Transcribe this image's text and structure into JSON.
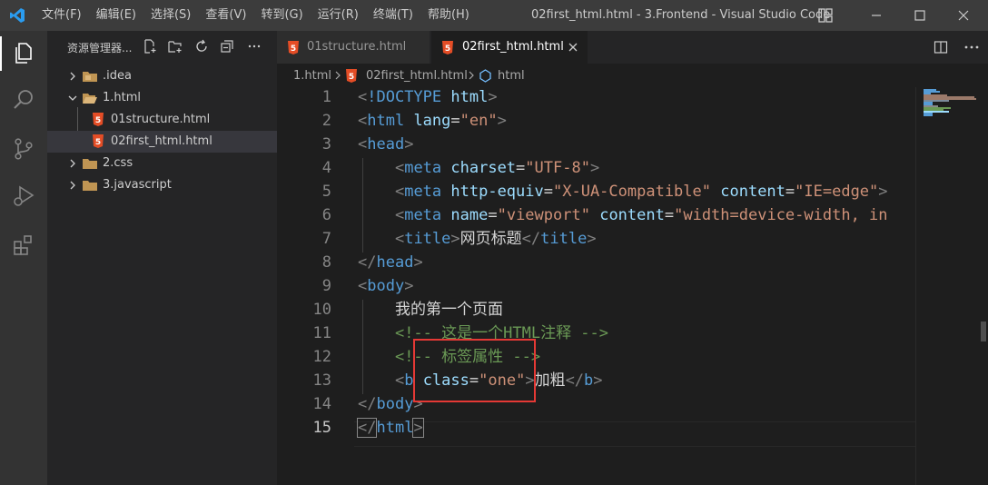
{
  "titlebar": {
    "menu": [
      "文件(F)",
      "编辑(E)",
      "选择(S)",
      "查看(V)",
      "转到(G)",
      "运行(R)",
      "终端(T)",
      "帮助(H)"
    ],
    "window_title": "02first_html.html - 3.Frontend - Visual Studio Code"
  },
  "sidebar": {
    "title": "资源管理器...",
    "tree": [
      {
        "label": ".idea",
        "type": "folder",
        "expanded": false
      },
      {
        "label": "1.html",
        "type": "folder",
        "expanded": true
      },
      {
        "label": "01structure.html",
        "type": "file-html"
      },
      {
        "label": "02first_html.html",
        "type": "file-html",
        "selected": true
      },
      {
        "label": "2.css",
        "type": "folder",
        "expanded": false
      },
      {
        "label": "3.javascript",
        "type": "folder",
        "expanded": false
      }
    ]
  },
  "tabs": [
    {
      "label": "01structure.html",
      "active": false
    },
    {
      "label": "02first_html.html",
      "active": true
    }
  ],
  "breadcrumb": [
    "1.html",
    "02first_html.html",
    "html"
  ],
  "editor": {
    "current_line": 15,
    "lines": [
      {
        "n": "1",
        "tokens": [
          [
            "t-punc",
            "<"
          ],
          [
            "t-tag",
            "!DOCTYPE "
          ],
          [
            "t-attr",
            "html"
          ],
          [
            "t-punc",
            ">"
          ]
        ]
      },
      {
        "n": "2",
        "tokens": [
          [
            "t-punc",
            "<"
          ],
          [
            "t-tag",
            "html "
          ],
          [
            "t-attr",
            "lang"
          ],
          [
            "t-text",
            "="
          ],
          [
            "t-str",
            "\"en\""
          ],
          [
            "t-punc",
            ">"
          ]
        ]
      },
      {
        "n": "3",
        "tokens": [
          [
            "t-punc",
            "<"
          ],
          [
            "t-tag",
            "head"
          ],
          [
            "t-punc",
            ">"
          ]
        ]
      },
      {
        "n": "4",
        "tokens": [
          [
            "t-text",
            "    "
          ],
          [
            "t-punc",
            "<"
          ],
          [
            "t-tag",
            "meta "
          ],
          [
            "t-attr",
            "charset"
          ],
          [
            "t-text",
            "="
          ],
          [
            "t-str",
            "\"UTF-8\""
          ],
          [
            "t-punc",
            ">"
          ]
        ]
      },
      {
        "n": "5",
        "tokens": [
          [
            "t-text",
            "    "
          ],
          [
            "t-punc",
            "<"
          ],
          [
            "t-tag",
            "meta "
          ],
          [
            "t-attr",
            "http-equiv"
          ],
          [
            "t-text",
            "="
          ],
          [
            "t-str",
            "\"X-UA-Compatible\""
          ],
          [
            "t-text",
            " "
          ],
          [
            "t-attr",
            "content"
          ],
          [
            "t-text",
            "="
          ],
          [
            "t-str",
            "\"IE=edge\""
          ],
          [
            "t-punc",
            ">"
          ]
        ]
      },
      {
        "n": "6",
        "tokens": [
          [
            "t-text",
            "    "
          ],
          [
            "t-punc",
            "<"
          ],
          [
            "t-tag",
            "meta "
          ],
          [
            "t-attr",
            "name"
          ],
          [
            "t-text",
            "="
          ],
          [
            "t-str",
            "\"viewport\""
          ],
          [
            "t-text",
            " "
          ],
          [
            "t-attr",
            "content"
          ],
          [
            "t-text",
            "="
          ],
          [
            "t-str",
            "\"width=device-width, in"
          ]
        ]
      },
      {
        "n": "7",
        "tokens": [
          [
            "t-text",
            "    "
          ],
          [
            "t-punc",
            "<"
          ],
          [
            "t-tag",
            "title"
          ],
          [
            "t-punc",
            ">"
          ],
          [
            "t-text",
            "网页标题"
          ],
          [
            "t-punc",
            "</"
          ],
          [
            "t-tag",
            "title"
          ],
          [
            "t-punc",
            ">"
          ]
        ]
      },
      {
        "n": "8",
        "tokens": [
          [
            "t-punc",
            "</"
          ],
          [
            "t-tag",
            "head"
          ],
          [
            "t-punc",
            ">"
          ]
        ]
      },
      {
        "n": "9",
        "tokens": [
          [
            "t-punc",
            "<"
          ],
          [
            "t-tag",
            "body"
          ],
          [
            "t-punc",
            ">"
          ]
        ]
      },
      {
        "n": "10",
        "tokens": [
          [
            "t-text",
            "    我的第一个页面"
          ]
        ]
      },
      {
        "n": "11",
        "tokens": [
          [
            "t-text",
            "    "
          ],
          [
            "t-cmt",
            "<!-- 这是一个HTML注释 -->"
          ]
        ]
      },
      {
        "n": "12",
        "tokens": [
          [
            "t-text",
            "    "
          ],
          [
            "t-cmt",
            "<!-- 标签属性 -->"
          ]
        ]
      },
      {
        "n": "13",
        "tokens": [
          [
            "t-text",
            "    "
          ],
          [
            "t-punc",
            "<"
          ],
          [
            "t-tag",
            "b "
          ],
          [
            "t-attr",
            "class"
          ],
          [
            "t-text",
            "="
          ],
          [
            "t-str",
            "\"one\""
          ],
          [
            "t-punc",
            ">"
          ],
          [
            "t-text",
            "加粗"
          ],
          [
            "t-punc",
            "</"
          ],
          [
            "t-tag",
            "b"
          ],
          [
            "t-punc",
            ">"
          ]
        ]
      },
      {
        "n": "14",
        "tokens": [
          [
            "t-punc",
            "</"
          ],
          [
            "t-tag",
            "body"
          ],
          [
            "t-punc",
            ">"
          ]
        ]
      },
      {
        "n": "15",
        "tokens": [
          [
            "t-punc",
            "</"
          ],
          [
            "t-tag",
            "html"
          ],
          [
            "t-punc",
            ">"
          ]
        ]
      }
    ]
  },
  "colors": {
    "accent": "#007acc",
    "html5_icon": "#e44d26",
    "folder": "#c09553",
    "highlight_box": "#e53935"
  },
  "icons": {
    "activity": [
      "explorer-icon",
      "search-icon",
      "source-control-icon",
      "run-debug-icon",
      "extensions-icon"
    ],
    "sidebar_actions": [
      "new-file-icon",
      "new-folder-icon",
      "refresh-icon",
      "collapse-all-icon",
      "more-icon"
    ]
  }
}
